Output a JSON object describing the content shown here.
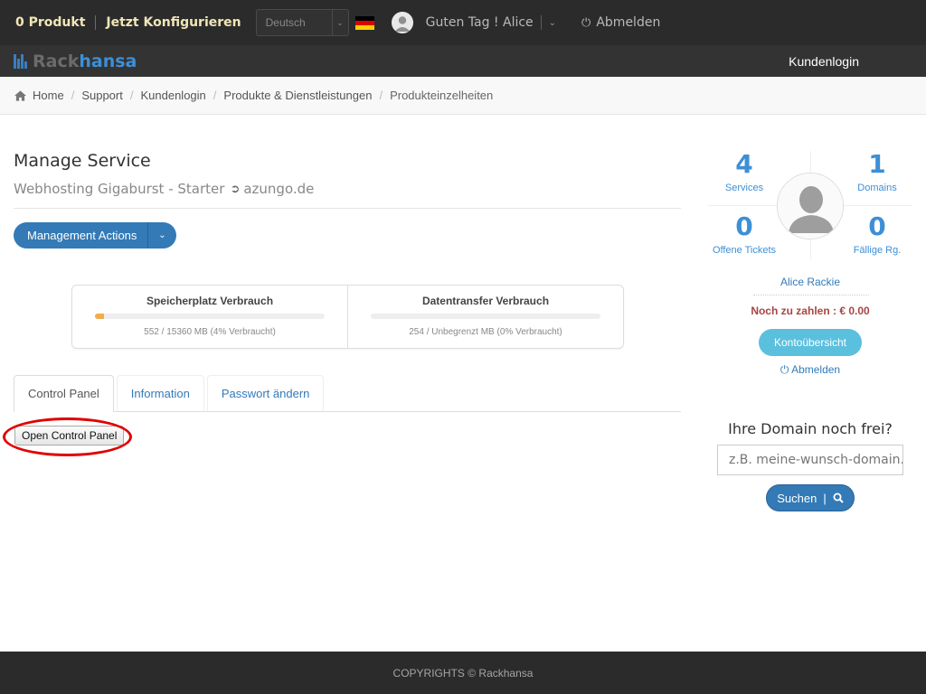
{
  "topbar": {
    "cart": "0 Produkt",
    "configure": "Jetzt Konfigurieren",
    "language": "Deutsch",
    "greeting": "Guten Tag ! Alice",
    "logout": "Abmelden"
  },
  "navbar": {
    "logo_part1": "Rack",
    "logo_part2": "hansa",
    "right_link": "Kundenlogin"
  },
  "breadcrumb": {
    "items": [
      "Home",
      "Support",
      "Kundenlogin",
      "Produkte & Dienstleistungen"
    ],
    "active": "Produkteinzelheiten"
  },
  "main": {
    "title": "Manage Service",
    "product": "Webhosting Gigaburst - Starter",
    "domain": "azungo.de",
    "actions_button": "Management Actions",
    "usage": [
      {
        "title": "Speicherplatz Verbrauch",
        "caption": "552 / 15360 MB (4% Verbraucht)",
        "percent": 4
      },
      {
        "title": "Datentransfer Verbrauch",
        "caption": "254 / Unbegrenzt MB (0% Verbraucht)",
        "percent": 0
      }
    ],
    "tabs": [
      "Control Panel",
      "Information",
      "Passwort ändern"
    ],
    "control_panel_button": "Open Control Panel"
  },
  "sidebar": {
    "stats": {
      "services": {
        "value": "4",
        "label": "Services"
      },
      "domains": {
        "value": "1",
        "label": "Domains"
      },
      "tickets": {
        "value": "0",
        "label": "Offene Tickets"
      },
      "invoices": {
        "value": "0",
        "label": "Fällige Rg."
      }
    },
    "name": "Alice Rackie",
    "due": "Noch zu zahlen : € 0.00",
    "account_button": "Kontoübersicht",
    "logout": "Abmelden",
    "domain_title": "Ihre Domain noch frei?",
    "domain_placeholder": "z.B. meine-wunsch-domain.de",
    "search_button": "Suchen"
  },
  "footer": {
    "copyright": "COPYRIGHTS © Rackhansa"
  },
  "colors": {
    "primary": "#337ab7",
    "info": "#5bc0de",
    "topbar": "#2b2b2b",
    "accent_yellow": "#f1e6b8",
    "danger": "#a94442",
    "annotation_red": "#e00000"
  }
}
